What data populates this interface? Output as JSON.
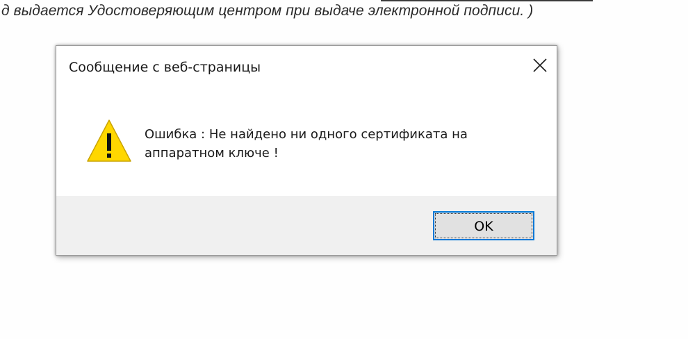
{
  "background_page": {
    "text": "д выдается Удостоверяющим центром при выдаче электронной подписи. )"
  },
  "dialog": {
    "title": "Сообщение с веб-страницы",
    "icon": "warning-icon",
    "message_line1": "Ошибка : Не найдено ни одного сертификата на",
    "message_line2": "аппаратном ключе !",
    "ok_label": "OK",
    "colors": {
      "accent": "#0078d7",
      "warning_fill": "#ffd700",
      "button_bar": "#f0f0f0"
    }
  }
}
